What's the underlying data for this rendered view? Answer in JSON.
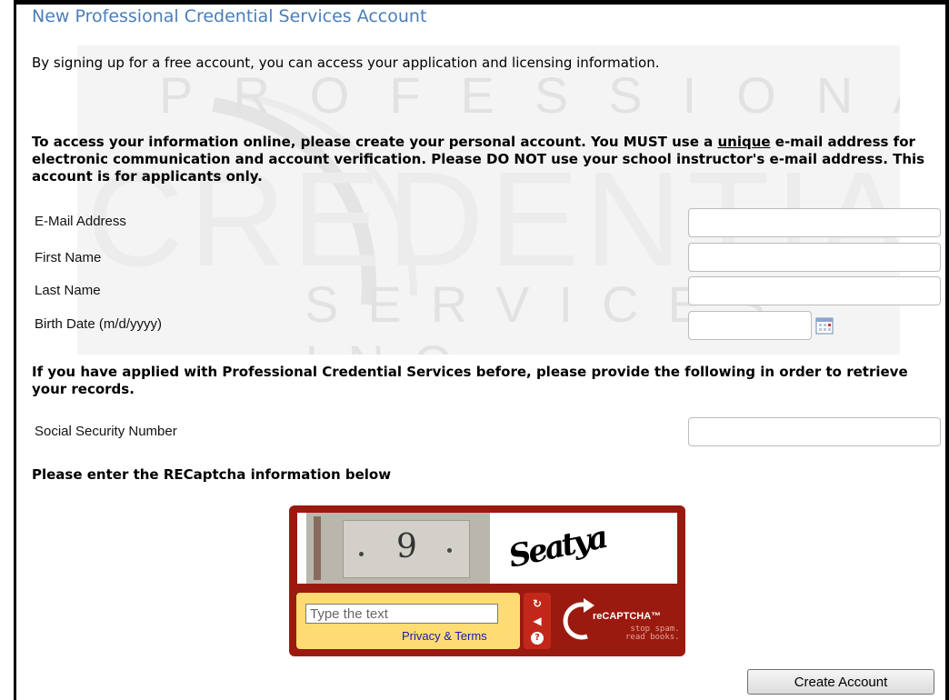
{
  "page": {
    "title": "New Professional Credential Services Account",
    "intro": "By signing up for a free account, you can access your application and licensing information."
  },
  "watermark": {
    "line1": "PROFESSIONAL",
    "line2": "CREDENTIAL",
    "line3": "SERVICES, INC."
  },
  "instructions": {
    "part1": "To access your information online, please create your personal account. You MUST use a ",
    "emphasis": "unique",
    "part2": " e-mail address for electronic communication and account verification.  Please DO NOT use your school instructor's e-mail address. This account is for applicants only."
  },
  "form": {
    "email_label": "E-Mail Address",
    "email_value": "",
    "first_name_label": "First Name",
    "first_name_value": "",
    "last_name_label": "Last Name",
    "last_name_value": "",
    "birth_date_label": "Birth Date (m/d/yyyy)",
    "birth_date_value": "",
    "calendar_icon": "calendar-icon"
  },
  "prior_records": {
    "note": "If you have applied with Professional Credential Services before, please provide the following in order to retrieve your records.",
    "ssn_label": "Social Security Number",
    "ssn_value": ""
  },
  "captcha": {
    "heading": "Please enter the RECaptcha information below",
    "image_digit": "9",
    "image_word": "Seatya",
    "input_placeholder": "Type the text",
    "privacy_link": "Privacy & Terms",
    "logo_text": "reCAPTCHA™",
    "tagline_line1": "stop spam.",
    "tagline_line2": "read books.",
    "reload_icon": "reload-icon",
    "audio_icon": "audio-icon",
    "help_icon": "help-icon",
    "colors": {
      "frame": "#9b1a0f",
      "answer_bg": "#ffdc73",
      "controls": "#c2281a"
    }
  },
  "actions": {
    "create_account_label": "Create Account"
  },
  "colors": {
    "title": "#4a7ebb",
    "link": "#1a1aa6"
  }
}
